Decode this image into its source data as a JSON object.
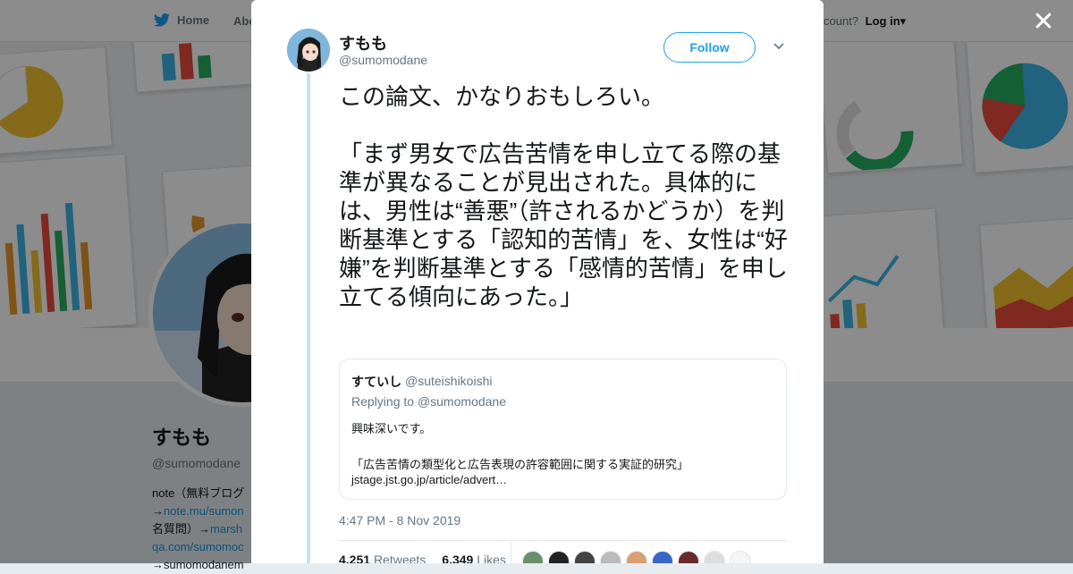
{
  "topbar": {
    "home_label": "Home",
    "about_label": "Abo",
    "account_prompt": "count?",
    "login_label": "Log in"
  },
  "profile": {
    "name": "すもも",
    "handle": "@sumomodane",
    "bio_line1": "note（無料ブログ",
    "bio_line2_prefix": "→",
    "bio_line2_link": "note.mu/sumon",
    "bio_line3_prefix": "名質問）→",
    "bio_line3_link": "marsh",
    "bio_line4_link": "qa.com/sumomoc",
    "bio_line5": "→sumomodanem"
  },
  "tweet": {
    "name": "すもも",
    "handle": "@sumomodane",
    "follow_label": "Follow",
    "text": "この論文、かなりおもしろい。\n\n「まず男女で広告苦情を申し立てる際の基準が異なることが見出された。具体的には、男性は“善悪”（許されるかどうか）を判断基準とする「認知的苦情」を、女性は“好嫌”を判断基準とする「感情的苦情」を申し立てる傾向にあった。」",
    "timestamp": "4:47 PM - 8 Nov 2019",
    "retweets_count": "4,251",
    "retweets_label": "Retweets",
    "likes_count": "6,349",
    "likes_label": "Likes"
  },
  "quote": {
    "name": "すていし",
    "handle": "@suteishikoishi",
    "replying_prefix": "Replying to",
    "replying_handle": "@sumomodane",
    "body": "興味深いです。\n\n「広告苦情の類型化と広告表現の許容範囲に関する実証的研究」",
    "link": "jstage.jst.go.jp/article/advert…"
  },
  "icons": {
    "bird": "twitter-bird-icon",
    "close": "close-icon",
    "caret": "chevron-down-icon"
  },
  "colors": {
    "brand": "#1da1f2",
    "thread": "#c3e4f8",
    "text": "#14171a",
    "muted": "#657786"
  }
}
